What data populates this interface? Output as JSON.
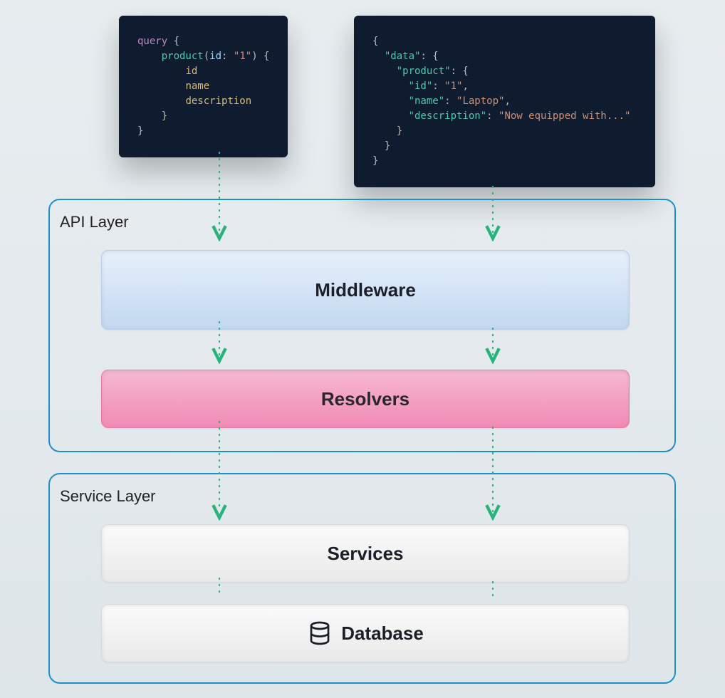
{
  "diagram": {
    "queryCode": {
      "tokens": [
        {
          "t": "query",
          "c": "tok-kw"
        },
        {
          "t": " {",
          "c": "tok-punc"
        },
        {
          "t": "\n    ",
          "c": ""
        },
        {
          "t": "product",
          "c": "tok-fn"
        },
        {
          "t": "(",
          "c": "tok-punc"
        },
        {
          "t": "id",
          "c": "tok-id"
        },
        {
          "t": ": ",
          "c": "tok-punc"
        },
        {
          "t": "\"1\"",
          "c": "tok-str"
        },
        {
          "t": ") {",
          "c": "tok-punc"
        },
        {
          "t": "\n        ",
          "c": ""
        },
        {
          "t": "id",
          "c": "tok-field"
        },
        {
          "t": "\n        ",
          "c": ""
        },
        {
          "t": "name",
          "c": "tok-field"
        },
        {
          "t": "\n        ",
          "c": ""
        },
        {
          "t": "description",
          "c": "tok-field"
        },
        {
          "t": "\n    }",
          "c": "tok-punc"
        },
        {
          "t": "\n}",
          "c": "tok-punc"
        }
      ]
    },
    "responseCode": {
      "tokens": [
        {
          "t": "{",
          "c": "tok-punc"
        },
        {
          "t": "\n  ",
          "c": ""
        },
        {
          "t": "\"data\"",
          "c": "tok-fn"
        },
        {
          "t": ": {",
          "c": "tok-punc"
        },
        {
          "t": "\n    ",
          "c": ""
        },
        {
          "t": "\"product\"",
          "c": "tok-fn"
        },
        {
          "t": ": {",
          "c": "tok-punc"
        },
        {
          "t": "\n      ",
          "c": ""
        },
        {
          "t": "\"id\"",
          "c": "tok-fn"
        },
        {
          "t": ": ",
          "c": "tok-punc"
        },
        {
          "t": "\"1\"",
          "c": "tok-str"
        },
        {
          "t": ",",
          "c": "tok-punc"
        },
        {
          "t": "\n      ",
          "c": ""
        },
        {
          "t": "\"name\"",
          "c": "tok-fn"
        },
        {
          "t": ": ",
          "c": "tok-punc"
        },
        {
          "t": "\"Laptop\"",
          "c": "tok-str"
        },
        {
          "t": ",",
          "c": "tok-punc"
        },
        {
          "t": "\n      ",
          "c": ""
        },
        {
          "t": "\"description\"",
          "c": "tok-fn"
        },
        {
          "t": ": ",
          "c": "tok-punc"
        },
        {
          "t": "\"Now equipped with...\"",
          "c": "tok-str"
        },
        {
          "t": "\n    }",
          "c": "tok-punc"
        },
        {
          "t": "\n  }",
          "c": "tok-punc"
        },
        {
          "t": "\n}",
          "c": "tok-punc"
        }
      ]
    },
    "layers": {
      "api": {
        "title": "API Layer",
        "middleware": "Middleware",
        "resolvers": "Resolvers"
      },
      "service": {
        "title": "Service Layer",
        "services": "Services",
        "database": "Database"
      }
    },
    "colors": {
      "arrowDown": "#2ab27b",
      "arrowUp": "#2ab27b",
      "layerBorder": "#1e90c8",
      "codeBg": "#0f1b2e"
    }
  }
}
